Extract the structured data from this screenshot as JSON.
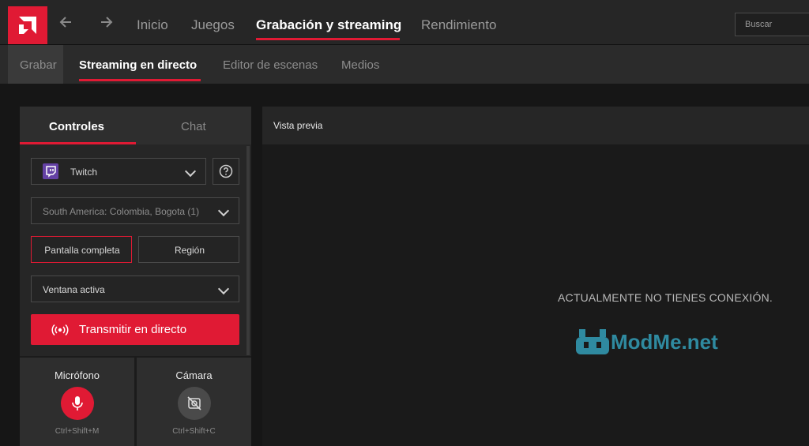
{
  "colors": {
    "accent": "#e01a34",
    "bg": "#161616",
    "panel": "#262626"
  },
  "icons": {
    "logo": "amd-logo-icon",
    "back": "arrow-left-icon",
    "forward": "arrow-right-icon",
    "twitch": "twitch-icon",
    "help": "question-circle-icon",
    "broadcast": "broadcast-icon",
    "mic": "microphone-icon",
    "camera": "camera-off-icon"
  },
  "nav": {
    "items": [
      {
        "label": "Inicio"
      },
      {
        "label": "Juegos"
      },
      {
        "label": "Grabación y streaming"
      },
      {
        "label": "Rendimiento"
      }
    ],
    "active_index": 2,
    "search_placeholder": "Buscar"
  },
  "subnav": {
    "items": [
      {
        "label": "Grabar"
      },
      {
        "label": "Streaming en directo"
      },
      {
        "label": "Editor de escenas"
      },
      {
        "label": "Medios"
      }
    ],
    "active_index": 1
  },
  "controls": {
    "tabs": [
      {
        "label": "Controles"
      },
      {
        "label": "Chat"
      }
    ],
    "active_tab": 0,
    "platform": "Twitch",
    "server": "South America: Colombia, Bogota (1)",
    "capture_modes": [
      {
        "label": "Pantalla completa"
      },
      {
        "label": "Región"
      }
    ],
    "selected_capture_mode": 0,
    "window_source": "Ventana activa",
    "stream_button": "Transmitir en directo",
    "microphone": {
      "label": "Micrófono",
      "shortcut": "Ctrl+Shift+M"
    },
    "camera": {
      "label": "Cámara",
      "shortcut": "Ctrl+Shift+C"
    }
  },
  "preview": {
    "title": "Vista previa",
    "status": "ACTUALMENTE NO TIENES CONEXIÓN."
  },
  "watermark": {
    "text": "ModMe.net"
  }
}
